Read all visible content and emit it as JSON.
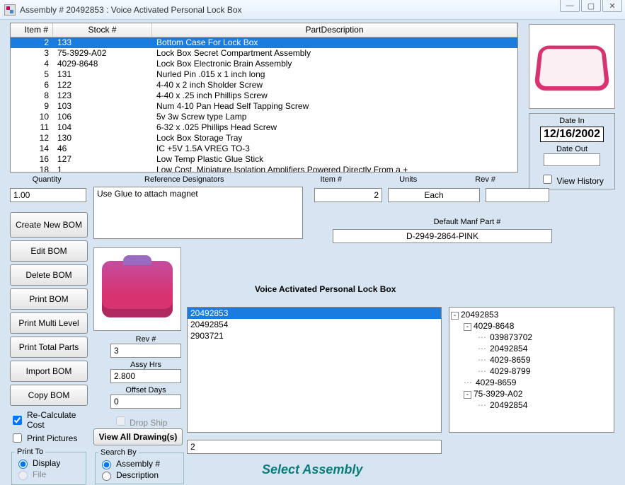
{
  "window": {
    "title": "Assembly # 20492853 : Voice Activated Personal  Lock Box"
  },
  "grid": {
    "headers": {
      "item": "Item #",
      "stock": "Stock #",
      "desc": "PartDescription"
    },
    "rows": [
      {
        "item": "2",
        "stock": "133",
        "desc": "Bottom Case For Lock Box",
        "selected": true
      },
      {
        "item": "3",
        "stock": "75-3929-A02",
        "desc": "Lock Box Secret Compartment Assembly"
      },
      {
        "item": "4",
        "stock": "4029-8648",
        "desc": "Lock Box Electronic Brain Assembly"
      },
      {
        "item": "5",
        "stock": "131",
        "desc": "Nurled Pin .015 x 1 inch long"
      },
      {
        "item": "6",
        "stock": "122",
        "desc": "4-40 x 2 inch Sholder Screw"
      },
      {
        "item": "8",
        "stock": "123",
        "desc": "4-40 x .25 inch Phillips Screw"
      },
      {
        "item": "9",
        "stock": "103",
        "desc": "Num 4-10  Pan Head Self Tapping Screw"
      },
      {
        "item": "10",
        "stock": "106",
        "desc": "5v 3w Screw type Lamp"
      },
      {
        "item": "11",
        "stock": "104",
        "desc": "6-32 x .025 Phillips Head Screw"
      },
      {
        "item": "12",
        "stock": "130",
        "desc": "Lock Box Storage Tray"
      },
      {
        "item": "14",
        "stock": "46",
        "desc": "IC +5V 1.5A VREG TO-3"
      },
      {
        "item": "16",
        "stock": "127",
        "desc": "Low Temp Plastic Glue Stick"
      },
      {
        "item": "18",
        "stock": "1",
        "desc": "Low Cost, Miniature Isolation Amplifiers Powered Directly From a +"
      }
    ]
  },
  "labels": {
    "quantity": "Quantity",
    "refdes": "Reference Designators",
    "item": "Item #",
    "units": "Units",
    "rev": "Rev #",
    "default_manf": "Default Manf Part #",
    "date_in": "Date In",
    "date_out": "Date Out",
    "view_history": "View History",
    "assy_hrs": "Assy Hrs",
    "offset_days": "Offset Days",
    "drop_ship": "Drop Ship",
    "search_by": "Search By",
    "print_to": "Print To",
    "recalc": "Re-Calculate Cost",
    "print_pics": "Print Pictures"
  },
  "values": {
    "quantity": "1.00",
    "refdes": "Use Glue to attach magnet",
    "item": "2",
    "units": "Each",
    "rev_top": "",
    "manf": "D-2949-2864-PINK",
    "date_in": "12/16/2002",
    "date_out": "",
    "rev2": "3",
    "assy_hrs": "2.800",
    "offset_days": "0",
    "search_val": "2"
  },
  "buttons": {
    "create": "Create New BOM",
    "edit": "Edit BOM",
    "delete": "Delete BOM",
    "print": "Print BOM",
    "print_multi": "Print Multi Level",
    "print_total": "Print Total Parts",
    "import": "Import BOM",
    "copy": "Copy BOM",
    "view_drawings": "View All Drawing(s)"
  },
  "radios": {
    "display": "Display",
    "file": "File",
    "assembly": "Assembly #",
    "description": "Description"
  },
  "assembly_name": "Voice Activated Personal  Lock Box",
  "assy_list": [
    {
      "id": "20492853",
      "selected": true
    },
    {
      "id": "20492854"
    },
    {
      "id": "2903721"
    }
  ],
  "tree": [
    {
      "lvl": 0,
      "tw": "-",
      "label": "20492853"
    },
    {
      "lvl": 1,
      "tw": "-",
      "label": "4029-8648"
    },
    {
      "lvl": 2,
      "dots": true,
      "label": "039873702"
    },
    {
      "lvl": 2,
      "dots": true,
      "label": "20492854"
    },
    {
      "lvl": 2,
      "dots": true,
      "label": "4029-8659"
    },
    {
      "lvl": 2,
      "dots": true,
      "label": "4029-8799"
    },
    {
      "lvl": 1,
      "dots": true,
      "label": "4029-8659"
    },
    {
      "lvl": 1,
      "tw": "-",
      "label": "75-3929-A02"
    },
    {
      "lvl": 2,
      "dots": true,
      "label": "20492854"
    }
  ],
  "footer": {
    "select_assembly": "Select Assembly"
  }
}
